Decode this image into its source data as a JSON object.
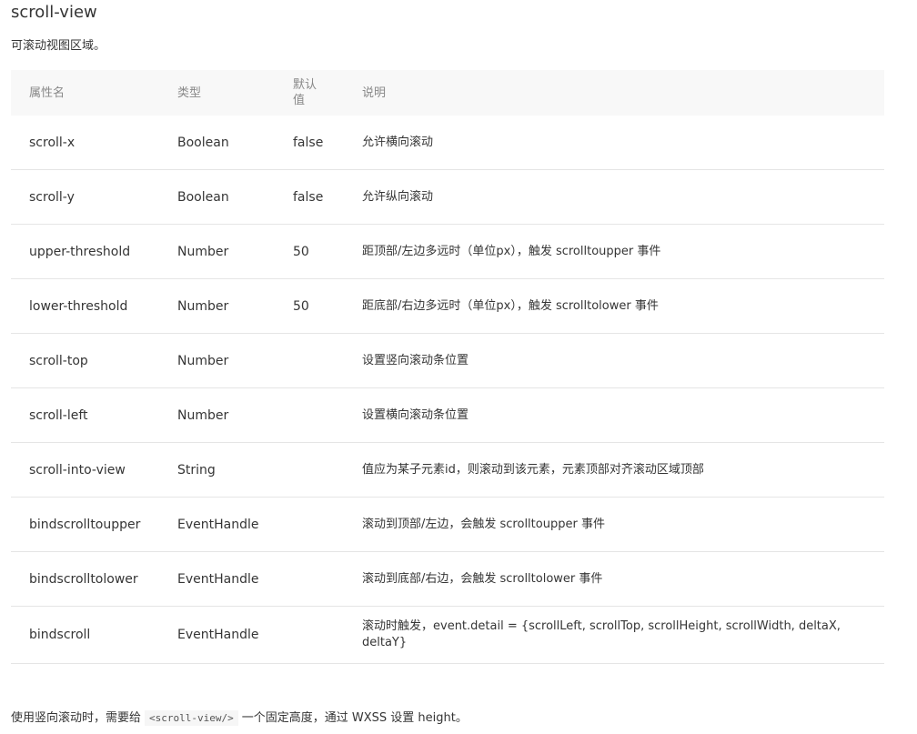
{
  "title": "scroll-view",
  "description": "可滚动视图区域。",
  "table": {
    "headers": {
      "name": "属性名",
      "type": "类型",
      "default": "默认值",
      "desc": "说明"
    },
    "rows": [
      {
        "name": "scroll-x",
        "type": "Boolean",
        "default": "false",
        "desc": "允许横向滚动"
      },
      {
        "name": "scroll-y",
        "type": "Boolean",
        "default": "false",
        "desc": "允许纵向滚动"
      },
      {
        "name": "upper-threshold",
        "type": "Number",
        "default": "50",
        "desc": "距顶部/左边多远时（单位px），触发 scrolltoupper 事件"
      },
      {
        "name": "lower-threshold",
        "type": "Number",
        "default": "50",
        "desc": "距底部/右边多远时（单位px），触发 scrolltolower 事件"
      },
      {
        "name": "scroll-top",
        "type": "Number",
        "default": "",
        "desc": "设置竖向滚动条位置"
      },
      {
        "name": "scroll-left",
        "type": "Number",
        "default": "",
        "desc": "设置横向滚动条位置"
      },
      {
        "name": "scroll-into-view",
        "type": "String",
        "default": "",
        "desc": "值应为某子元素id，则滚动到该元素，元素顶部对齐滚动区域顶部"
      },
      {
        "name": "bindscrolltoupper",
        "type": "EventHandle",
        "default": "",
        "desc": "滚动到顶部/左边，会触发 scrolltoupper 事件"
      },
      {
        "name": "bindscrolltolower",
        "type": "EventHandle",
        "default": "",
        "desc": "滚动到底部/右边，会触发 scrolltolower 事件"
      },
      {
        "name": "bindscroll",
        "type": "EventHandle",
        "default": "",
        "desc": "滚动时触发，event.detail = {scrollLeft, scrollTop, scrollHeight, scrollWidth, deltaX, deltaY}"
      }
    ]
  },
  "note": {
    "before": "使用竖向滚动时，需要给",
    "code": "<scroll-view/>",
    "after": "一个固定高度，通过 WXSS 设置 height。"
  }
}
